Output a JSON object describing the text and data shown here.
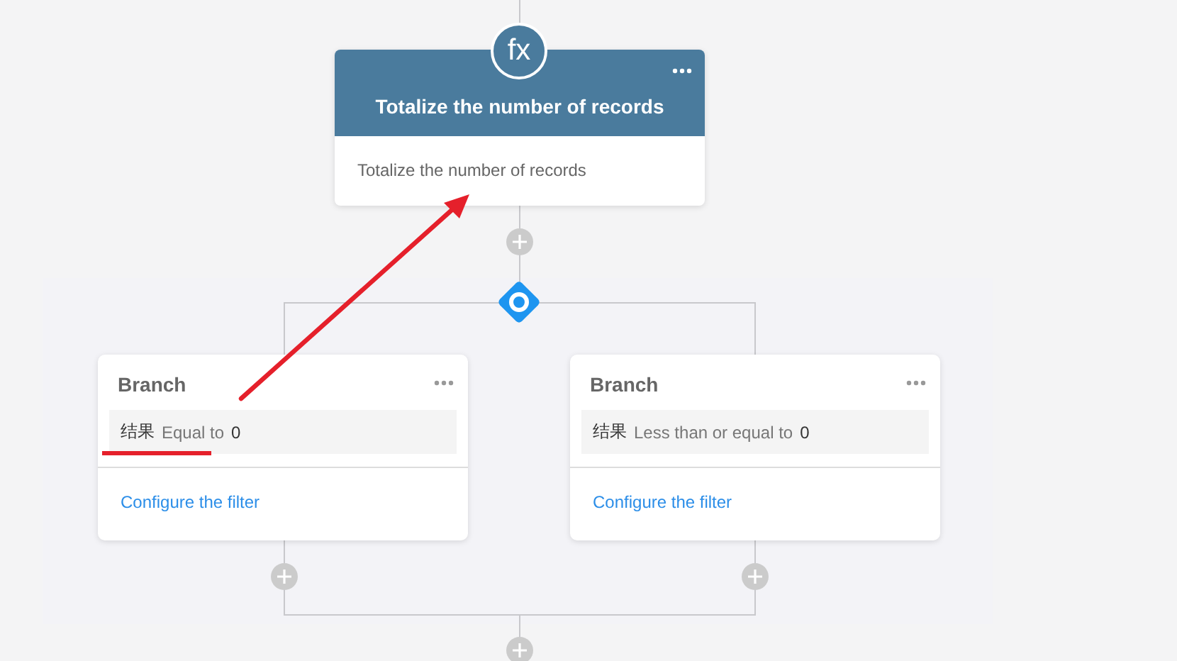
{
  "action_node": {
    "icon": "fx",
    "title": "Totalize the number of records",
    "description": "Totalize the number of records"
  },
  "branches": [
    {
      "title": "Branch",
      "field": "结果",
      "operator": "Equal to",
      "value": "0",
      "link": "Configure the filter",
      "annotated": true
    },
    {
      "title": "Branch",
      "field": "结果",
      "operator": "Less than or equal to",
      "value": "0",
      "link": "Configure the filter",
      "annotated": false
    }
  ]
}
